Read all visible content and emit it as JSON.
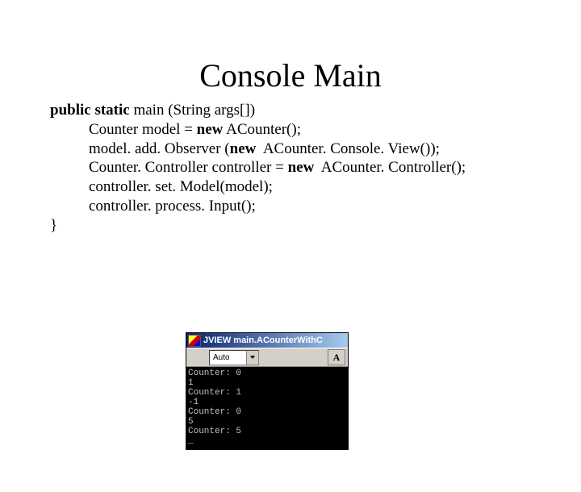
{
  "title": "Console Main",
  "code": {
    "sig_bold": "public static ",
    "sig_rest": "main (String args[])",
    "l1a": "Counter model = ",
    "l1b": "new",
    "l1c": " ACounter();",
    "l2a": "model. add. Observer (",
    "l2b": "new",
    "l2c": "  ACounter. Console. View());",
    "l3a": "Counter. Controller controller = ",
    "l3b": "new",
    "l3c": "  ACounter. Controller();",
    "l4": "controller. set. Model(model);",
    "l5": "controller. process. Input();",
    "close": "}"
  },
  "window": {
    "title": "JVIEW main.ACounterWithC",
    "dropdown_value": "Auto",
    "font_glyph": "A"
  },
  "console_lines": [
    "Counter: 0",
    "1",
    "Counter: 1",
    "-1",
    "Counter: 0",
    "5",
    "Counter: 5",
    "_"
  ]
}
